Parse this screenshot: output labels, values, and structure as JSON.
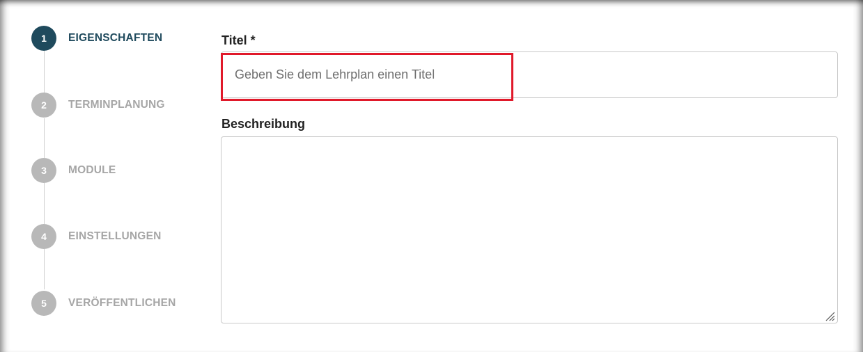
{
  "stepper": {
    "steps": [
      {
        "number": "1",
        "label": "EIGENSCHAFTEN",
        "state": "active"
      },
      {
        "number": "2",
        "label": "TERMINPLANUNG",
        "state": "inactive"
      },
      {
        "number": "3",
        "label": "MODULE",
        "state": "inactive"
      },
      {
        "number": "4",
        "label": "EINSTELLUNGEN",
        "state": "inactive"
      },
      {
        "number": "5",
        "label": "VERÖFFENTLICHEN",
        "state": "inactive"
      }
    ]
  },
  "form": {
    "title_label": "Titel *",
    "title_placeholder": "Geben Sie dem Lehrplan einen Titel",
    "title_value": "",
    "description_label": "Beschreibung",
    "description_value": ""
  },
  "colors": {
    "active_step": "#1f4a5d",
    "inactive_step": "#b8b8b8",
    "highlight": "#e0192a"
  }
}
